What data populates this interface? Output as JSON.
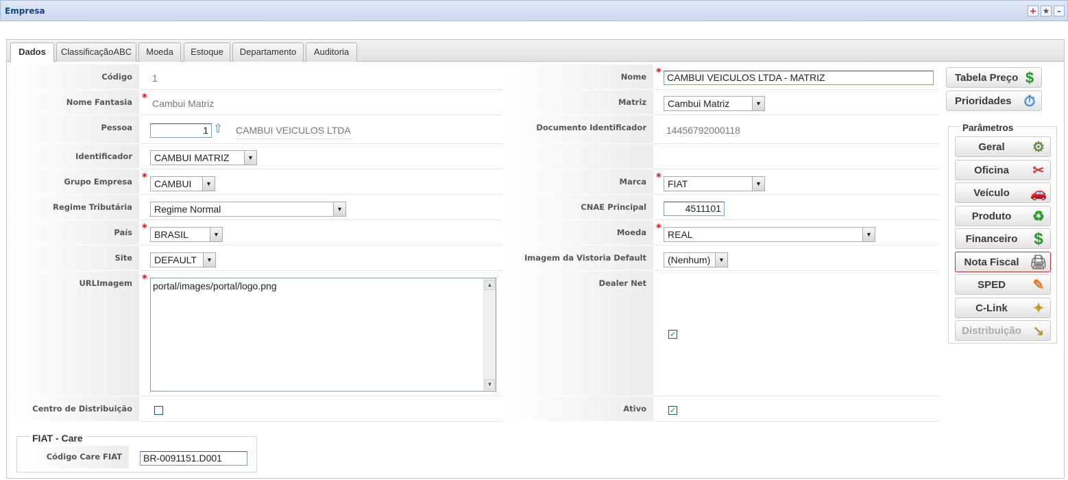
{
  "window": {
    "title": "Empresa",
    "icons": [
      "add-icon",
      "star-icon",
      "minimize-icon"
    ]
  },
  "tabs": [
    "Dados",
    "ClassificaçãoABC",
    "Moeda",
    "Estoque",
    "Departamento",
    "Auditoria"
  ],
  "form": {
    "codigo": {
      "label": "Código",
      "value": "1"
    },
    "nome": {
      "label": "Nome",
      "value": "CAMBUI VEICULOS LTDA - MATRIZ"
    },
    "nome_fantasia": {
      "label": "Nome Fantasia",
      "value": "Cambui Matriz"
    },
    "matriz": {
      "label": "Matriz",
      "value": "Cambui Matriz"
    },
    "pessoa": {
      "label": "Pessoa",
      "value": "1",
      "description": "CAMBUI VEICULOS LTDA"
    },
    "documento": {
      "label": "Documento Identificador",
      "value": "14456792000118"
    },
    "identificador": {
      "label": "Identificador",
      "value": "CAMBUI MATRIZ"
    },
    "grupo_empresa": {
      "label": "Grupo Empresa",
      "value": "CAMBUI"
    },
    "marca": {
      "label": "Marca",
      "value": "FIAT"
    },
    "regime": {
      "label": "Regime Tributária",
      "value": "Regime Normal"
    },
    "cnae": {
      "label": "CNAE Principal",
      "value": "4511101"
    },
    "pais": {
      "label": "País",
      "value": "BRASIL"
    },
    "moeda": {
      "label": "Moeda",
      "value": "REAL"
    },
    "site": {
      "label": "Site",
      "value": "DEFAULT"
    },
    "imagem_vistoria": {
      "label": "Imagem da Vistoria Default",
      "value": "(Nenhum)"
    },
    "url_imagem": {
      "label": "URLImagem",
      "value": "portal/images/portal/logo.png"
    },
    "dealer_net": {
      "label": "Dealer Net",
      "checked": true
    },
    "centro_distribuicao": {
      "label": "Centro de Distribuição",
      "checked": false
    },
    "ativo": {
      "label": "Ativo",
      "checked": true
    }
  },
  "fiat_care": {
    "legend": "FIAT - Care",
    "label": "Código Care FIAT",
    "value": "BR-0091151.D001"
  },
  "side_buttons": {
    "tabela_preco": "Tabela Preço",
    "prioridades": "Prioridades"
  },
  "parametros": {
    "legend": "Parâmetros",
    "buttons": [
      "Geral",
      "Oficina",
      "Veículo",
      "Produto",
      "Financeiro",
      "Nota Fiscal",
      "SPED",
      "C-Link",
      "Distribuição"
    ]
  },
  "colors": {
    "required": "#dd1111",
    "title": "#15428b",
    "highlight_border": "#c7283a"
  }
}
